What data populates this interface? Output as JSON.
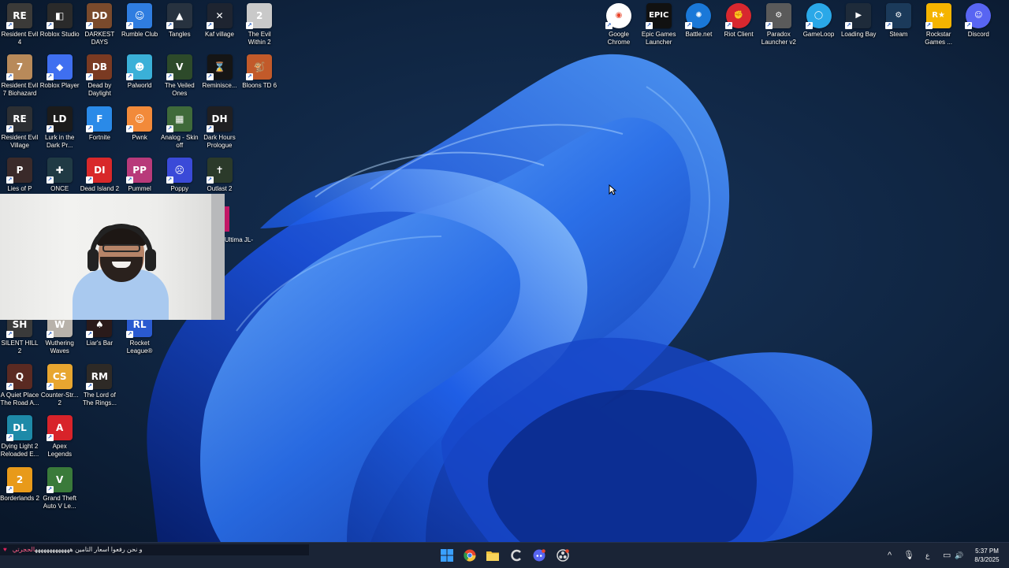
{
  "desktop": {
    "icons_left": [
      {
        "label": "Resident Evil 4",
        "icon": "resident-evil-4-icon",
        "color": "#3b3a38",
        "glyph": "RE"
      },
      {
        "label": "Roblox Studio",
        "icon": "roblox-studio-icon",
        "color": "#2a2a2a",
        "glyph": "◧"
      },
      {
        "label": "DARKEST DAYS",
        "icon": "darkest-days-icon",
        "color": "#7a4a2c",
        "glyph": "DD"
      },
      {
        "label": "Rumble Club",
        "icon": "rumble-club-icon",
        "color": "#2f7de0",
        "glyph": "☺"
      },
      {
        "label": "Tangles",
        "icon": "tangles-icon",
        "color": "#27323f",
        "glyph": "▲"
      },
      {
        "label": "Kaf village",
        "icon": "kaf-village-icon",
        "color": "#1e2430",
        "glyph": "✕"
      },
      {
        "label": "The Evil Within 2",
        "icon": "the-evil-within-2-icon",
        "color": "#c9c9c9",
        "glyph": "2"
      },
      {
        "label": "Resident Evil 7 Biohazard",
        "icon": "resident-evil-7-icon",
        "color": "#b88a5a",
        "glyph": "7"
      },
      {
        "label": "Roblox Player",
        "icon": "roblox-player-icon",
        "color": "#3f6ff0",
        "glyph": "◆"
      },
      {
        "label": "Dead by Daylight",
        "icon": "dead-by-daylight-icon",
        "color": "#7a3a22",
        "glyph": "DB"
      },
      {
        "label": "Palworld",
        "icon": "palworld-icon",
        "color": "#3ab0d8",
        "glyph": "☻"
      },
      {
        "label": "The Veiled Ones",
        "icon": "the-veiled-ones-icon",
        "color": "#2d4a2a",
        "glyph": "V"
      },
      {
        "label": "Reminisce...",
        "icon": "reminiscence-icon",
        "color": "#151515",
        "glyph": "⌛"
      },
      {
        "label": "Bloons TD 6",
        "icon": "bloons-td-6-icon",
        "color": "#c25a2a",
        "glyph": "🐒"
      },
      {
        "label": "Resident Evil Village",
        "icon": "resident-evil-village-icon",
        "color": "#2c2f33",
        "glyph": "RE"
      },
      {
        "label": "Lurk in the Dark  Pr...",
        "icon": "lurk-in-the-dark-icon",
        "color": "#1b1b1b",
        "glyph": "LD"
      },
      {
        "label": "Fortnite",
        "icon": "fortnite-icon",
        "color": "#2a8ae8",
        "glyph": "F"
      },
      {
        "label": "Pwnk",
        "icon": "pwnk-icon",
        "color": "#f28a3a",
        "glyph": "☺"
      },
      {
        "label": "Analog - Skin off",
        "icon": "analog-skin-off-icon",
        "color": "#3f6a3a",
        "glyph": "▦"
      },
      {
        "label": "Dark Hours Prologue",
        "icon": "dark-hours-prologue-icon",
        "color": "#1f1f22",
        "glyph": "DH"
      },
      {
        "label": "Lies of P",
        "icon": "lies-of-p-icon",
        "color": "#3a2a2a",
        "glyph": "P"
      },
      {
        "label": "ONCE",
        "icon": "once-icon",
        "color": "#203a44",
        "glyph": "✚"
      },
      {
        "label": "Dead Island 2",
        "icon": "dead-island-2-icon",
        "color": "#d8282a",
        "glyph": "DI"
      },
      {
        "label": "Pummel",
        "icon": "pummel-party-icon",
        "color": "#b83a7a",
        "glyph": "PP"
      },
      {
        "label": "Poppy",
        "icon": "poppy-playtime-icon",
        "color": "#3a4ad8",
        "glyph": "☹"
      },
      {
        "label": "Outlast 2",
        "icon": "outlast-2-icon",
        "color": "#2b3a2a",
        "glyph": "✝"
      },
      {
        "label": "SILENT HILL 2",
        "icon": "silent-hill-2-icon",
        "color": "#3a3a3a",
        "glyph": "SH"
      },
      {
        "label": "Wuthering Waves",
        "icon": "wuthering-waves-icon",
        "color": "#b8b2aa",
        "glyph": "W"
      },
      {
        "label": "Liar's Bar",
        "icon": "liars-bar-icon",
        "color": "#2a1a1a",
        "glyph": "♠"
      },
      {
        "label": "Rocket League®",
        "icon": "rocket-league-icon",
        "color": "#2a5ad0",
        "glyph": "RL"
      },
      {
        "label": "A Quiet Place The Road A...",
        "icon": "a-quiet-place-icon",
        "color": "#5a2a22",
        "glyph": "Q"
      },
      {
        "label": "Counter-Str... 2",
        "icon": "counter-strike-2-icon",
        "color": "#e8a630",
        "glyph": "CS"
      },
      {
        "label": "The Lord of The Rings...",
        "icon": "lord-of-the-rings-icon",
        "color": "#2e2a26",
        "glyph": "RM"
      },
      {
        "label": "Dying Light 2 Reloaded E...",
        "icon": "dying-light-2-icon",
        "color": "#1e8aa8",
        "glyph": "DL"
      },
      {
        "label": "Apex Legends",
        "icon": "apex-legends-icon",
        "color": "#d8232a",
        "glyph": "A"
      },
      {
        "label": "Borderlands 2",
        "icon": "borderlands-2-icon",
        "color": "#e89a1a",
        "glyph": "2"
      },
      {
        "label": "Grand Theft Auto V Le...",
        "icon": "gta-v-icon",
        "color": "#3a7a3a",
        "glyph": "V"
      }
    ],
    "icons_right": [
      {
        "label": "Google Chrome",
        "icon": "google-chrome-icon",
        "color": "#ffffff",
        "glyph": "◉"
      },
      {
        "label": "Epic Games Launcher",
        "icon": "epic-games-icon",
        "color": "#111111",
        "glyph": "EPIC"
      },
      {
        "label": "Battle.net",
        "icon": "battle-net-icon",
        "color": "#1a78d8",
        "glyph": "✺"
      },
      {
        "label": "Riot Client",
        "icon": "riot-client-icon",
        "color": "#d8282f",
        "glyph": "✊"
      },
      {
        "label": "Paradox Launcher v2",
        "icon": "paradox-launcher-icon",
        "color": "#5a5a5a",
        "glyph": "⚙"
      },
      {
        "label": "GameLoop",
        "icon": "gameloop-icon",
        "color": "#2aa8e8",
        "glyph": "◯"
      },
      {
        "label": "Loading Bay",
        "icon": "loading-bay-icon",
        "color": "#1e2b3a",
        "glyph": "▶"
      },
      {
        "label": "Steam",
        "icon": "steam-icon",
        "color": "#1b3a5a",
        "glyph": "⚙"
      },
      {
        "label": "Rockstar Games ...",
        "icon": "rockstar-games-icon",
        "color": "#f5b400",
        "glyph": "R★"
      },
      {
        "label": "Discord",
        "icon": "discord-icon",
        "color": "#5865f2",
        "glyph": "☺"
      }
    ],
    "partial_label": "Ultima JL-"
  },
  "taskbar": {
    "chat_ticker": {
      "heart_icon": "heart-icon",
      "message": "و نحن رفعوا اسعار التامين ههههههههههههه",
      "username": "الحجرتي"
    },
    "apps": [
      {
        "name": "start-button",
        "icon": "windows-logo-icon",
        "color": "#3aa0ff"
      },
      {
        "name": "taskbar-chrome",
        "icon": "google-chrome-icon",
        "color": "#e8442a"
      },
      {
        "name": "taskbar-file-explorer",
        "icon": "folder-icon",
        "color": "#f2c23a"
      },
      {
        "name": "taskbar-ccleaner",
        "icon": "ccleaner-icon",
        "color": "#d8d8d8"
      },
      {
        "name": "taskbar-discord",
        "icon": "discord-icon",
        "color": "#5865f2"
      },
      {
        "name": "taskbar-obs",
        "icon": "obs-icon",
        "color": "#3a3a3a"
      }
    ],
    "tray": {
      "chevron": "^",
      "mic": "🎙",
      "language": "ع",
      "network": "▭",
      "volume": "🔊"
    },
    "clock": {
      "time": "5:37 PM",
      "date": "8/3/2025"
    }
  }
}
